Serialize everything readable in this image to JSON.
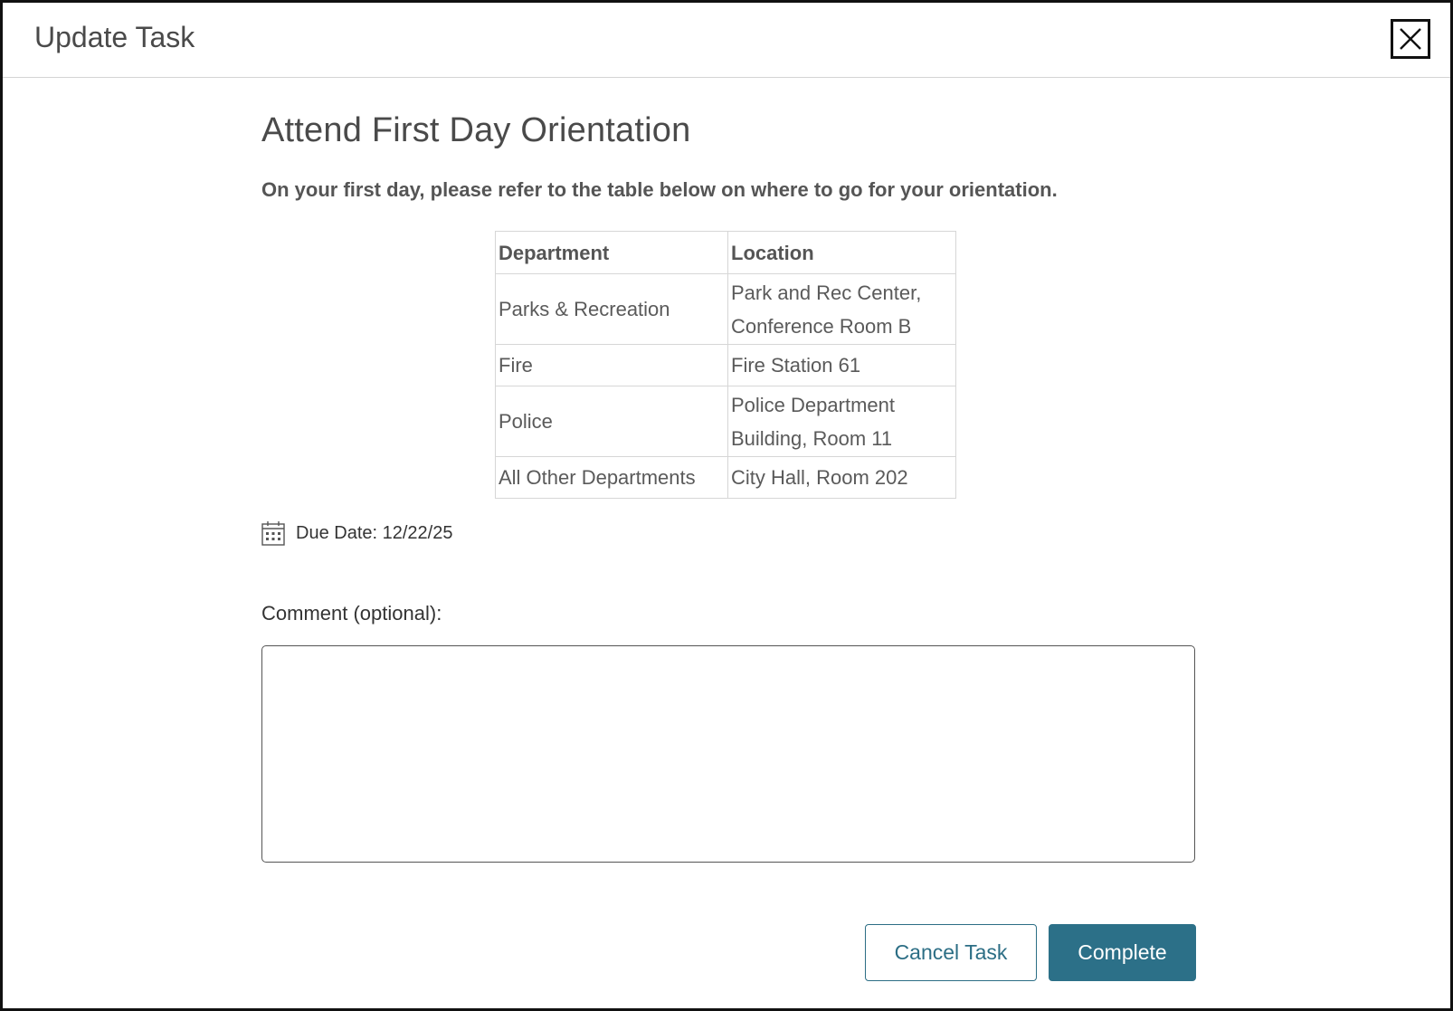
{
  "header": {
    "title": "Update Task",
    "close_icon": "close-icon"
  },
  "task": {
    "title": "Attend First Day Orientation",
    "description": "On your first day, please refer to the table below on where to go for your orientation.",
    "table": {
      "headers": [
        "Department",
        "Location"
      ],
      "rows": [
        {
          "department": "Parks & Recreation",
          "location": "Park and Rec Center, Conference Room B"
        },
        {
          "department": "Fire",
          "location": "Fire Station 61"
        },
        {
          "department": "Police",
          "location": "Police Department Building, Room 11"
        },
        {
          "department": "All Other Departments",
          "location": "City Hall, Room 202"
        }
      ]
    },
    "due_date": {
      "icon": "calendar-icon",
      "text": "Due Date: 12/22/25"
    }
  },
  "comment": {
    "label": "Comment (optional):",
    "value": "",
    "placeholder": ""
  },
  "actions": {
    "cancel_label": "Cancel Task",
    "complete_label": "Complete"
  },
  "colors": {
    "accent": "#2c7088",
    "border_dark": "#111111",
    "text_muted": "#4a4a4a"
  }
}
